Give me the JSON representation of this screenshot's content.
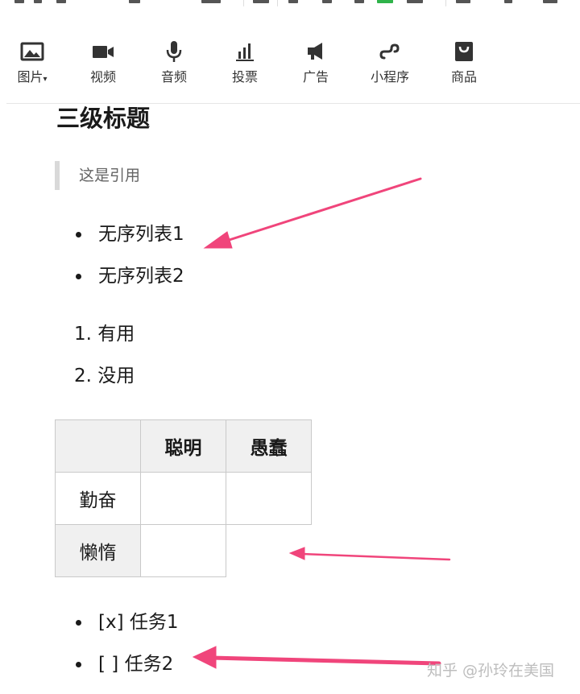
{
  "toolbar": {
    "items": [
      {
        "label": "图片",
        "suffix": "▾",
        "icon": "image-icon"
      },
      {
        "label": "视频",
        "icon": "video-icon"
      },
      {
        "label": "音频",
        "icon": "microphone-icon"
      },
      {
        "label": "投票",
        "icon": "poll-chart-icon"
      },
      {
        "label": "广告",
        "icon": "megaphone-icon"
      },
      {
        "label": "小程序",
        "icon": "mini-program-icon"
      },
      {
        "label": "商品",
        "icon": "shopping-bag-icon"
      }
    ]
  },
  "content": {
    "heading": "三级标题",
    "quote": "这是引用",
    "unordered": [
      "无序列表1",
      "无序列表2"
    ],
    "ordered": [
      "1. 有用",
      "2. 没用"
    ],
    "table": {
      "header": [
        "",
        "聪明",
        "愚蠢"
      ],
      "rows": [
        {
          "label": "勤奋",
          "cells": [
            "",
            ""
          ]
        },
        {
          "label": "懒惰",
          "cells": [
            ""
          ]
        }
      ]
    },
    "tasks": [
      "[x] 任务1",
      "[ ] 任务2"
    ]
  },
  "annotations": {
    "arrow_color": "#f0457b"
  },
  "watermark": "知乎 @孙玲在美国"
}
